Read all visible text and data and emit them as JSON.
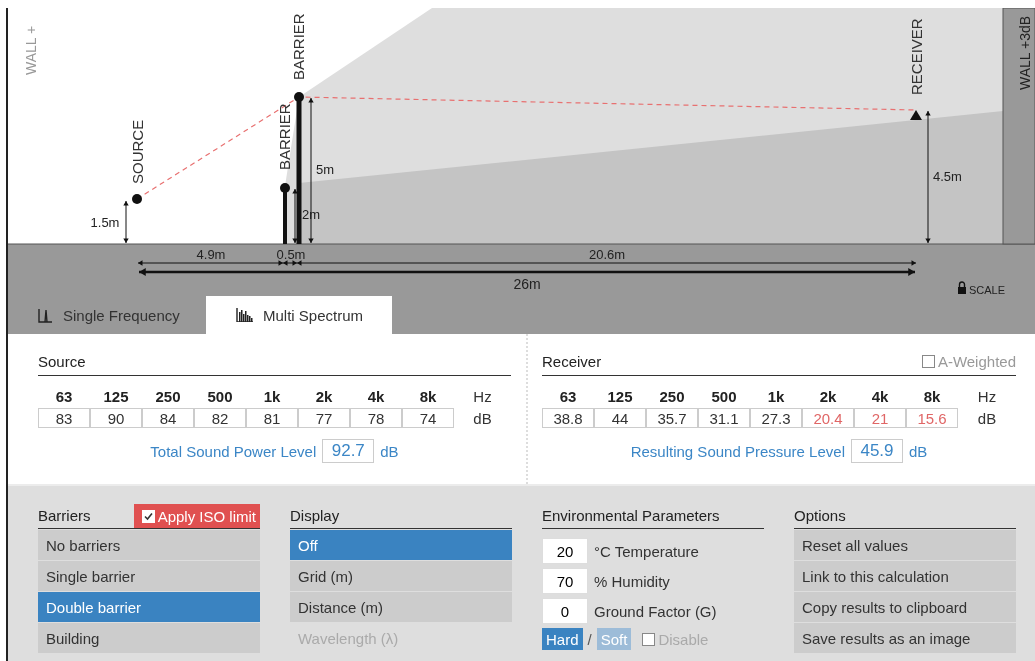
{
  "diagram": {
    "wall_left": "WALL +",
    "wall_right": "WALL +3dB",
    "source": {
      "label": "SOURCE",
      "height": "1.5m"
    },
    "barriers": [
      {
        "label": "BARRIER",
        "height": "2m"
      },
      {
        "label": "BARRIER",
        "height": "5m"
      }
    ],
    "receiver": {
      "label": "RECEIVER",
      "height": "4.5m"
    },
    "distances": [
      "4.9m",
      "0.5m",
      "20.6m"
    ],
    "total_distance": "26m",
    "scale": "SCALE"
  },
  "tabs": [
    {
      "label": "Single Frequency",
      "selected": false
    },
    {
      "label": "Multi Spectrum",
      "selected": true
    }
  ],
  "source": {
    "title": "Source",
    "frequencies": [
      "63",
      "125",
      "250",
      "500",
      "1k",
      "2k",
      "4k",
      "8k"
    ],
    "unit_hz": "Hz",
    "unit_db": "dB",
    "values": [
      {
        "value": "83",
        "color": "#333333"
      },
      {
        "value": "90",
        "color": "#333333"
      },
      {
        "value": "84",
        "color": "#333333"
      },
      {
        "value": "82",
        "color": "#333333"
      },
      {
        "value": "81",
        "color": "#333333"
      },
      {
        "value": "77",
        "color": "#333333"
      },
      {
        "value": "78",
        "color": "#333333"
      },
      {
        "value": "74",
        "color": "#333333"
      }
    ],
    "total": {
      "label": "Total Sound Power Level",
      "value": "92.7",
      "unit": "dB"
    }
  },
  "receiver": {
    "title": "Receiver",
    "a_weighted": {
      "label": "A-Weighted",
      "checked": false
    },
    "frequencies": [
      "63",
      "125",
      "250",
      "500",
      "1k",
      "2k",
      "4k",
      "8k"
    ],
    "unit_hz": "Hz",
    "unit_db": "dB",
    "values": [
      {
        "value": "38.8",
        "color": "#333333"
      },
      {
        "value": "44",
        "color": "#333333"
      },
      {
        "value": "35.7",
        "color": "#333333"
      },
      {
        "value": "31.1",
        "color": "#333333"
      },
      {
        "value": "27.3",
        "color": "#333333"
      },
      {
        "value": "20.4",
        "color": "#e06666"
      },
      {
        "value": "21",
        "color": "#e06666"
      },
      {
        "value": "15.6",
        "color": "#e06666"
      }
    ],
    "total": {
      "label": "Resulting Sound Pressure Level",
      "value": "45.9",
      "unit": "dB"
    }
  },
  "barriers": {
    "title": "Barriers",
    "iso_limit": {
      "label": "Apply ISO limit",
      "checked": true
    },
    "items": [
      {
        "label": "No barriers",
        "selected": false
      },
      {
        "label": "Single barrier",
        "selected": false
      },
      {
        "label": "Double barrier",
        "selected": true
      },
      {
        "label": "Building",
        "selected": false
      }
    ]
  },
  "display": {
    "title": "Display",
    "items": [
      {
        "label": "Off",
        "selected": true,
        "disabled": false
      },
      {
        "label": "Grid (m)",
        "selected": false,
        "disabled": false
      },
      {
        "label": "Distance (m)",
        "selected": false,
        "disabled": false
      },
      {
        "label": "Wavelength (λ)",
        "selected": false,
        "disabled": true
      }
    ]
  },
  "environment": {
    "title": "Environmental Parameters",
    "params": [
      {
        "value": "20",
        "label": "°C Temperature"
      },
      {
        "value": "70",
        "label": "% Humidity"
      },
      {
        "value": "0",
        "label": "Ground Factor (G)"
      }
    ],
    "ground": [
      {
        "label": "Hard",
        "selected": true
      },
      {
        "label": "Soft",
        "selected": false
      }
    ],
    "separator": "/",
    "disable": {
      "label": "Disable",
      "checked": false
    }
  },
  "options": {
    "title": "Options",
    "items": [
      "Reset all values",
      "Link to this calculation",
      "Copy results to clipboard",
      "Save results as an image"
    ]
  }
}
